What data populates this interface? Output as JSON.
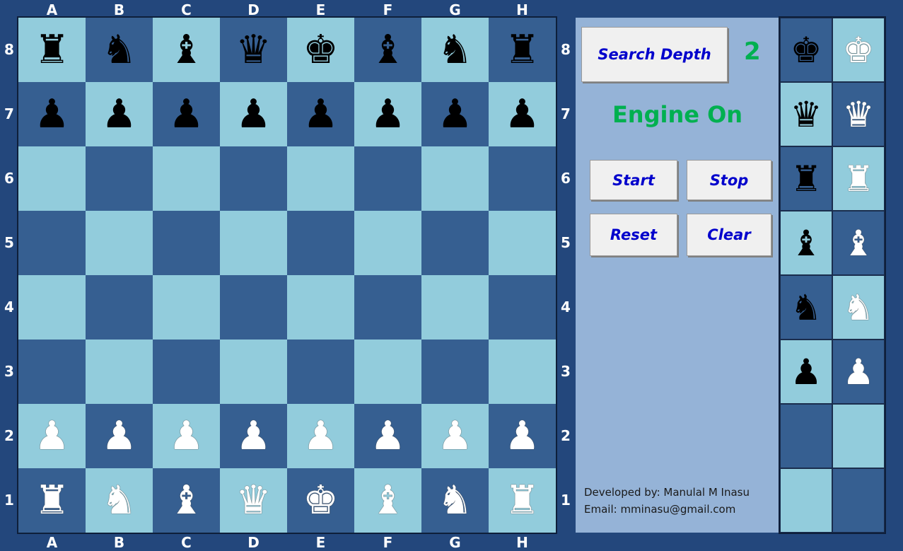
{
  "files": [
    "A",
    "B",
    "C",
    "D",
    "E",
    "F",
    "G",
    "H"
  ],
  "ranks": [
    "8",
    "7",
    "6",
    "5",
    "4",
    "3",
    "2",
    "1"
  ],
  "colors": {
    "light_square": "#92ccdc",
    "dark_square": "#365f91",
    "panel": "#95b3d7",
    "accent_green": "#00b050",
    "button_text": "#0000cc"
  },
  "board": [
    [
      {
        "glyph": "♜",
        "color": "black",
        "piece": "rook-icon"
      },
      {
        "glyph": "♞",
        "color": "black",
        "piece": "knight-icon"
      },
      {
        "glyph": "♝",
        "color": "black",
        "piece": "bishop-icon"
      },
      {
        "glyph": "♛",
        "color": "black",
        "piece": "queen-icon"
      },
      {
        "glyph": "♚",
        "color": "black",
        "piece": "king-icon"
      },
      {
        "glyph": "♝",
        "color": "black",
        "piece": "bishop-icon"
      },
      {
        "glyph": "♞",
        "color": "black",
        "piece": "knight-icon"
      },
      {
        "glyph": "♜",
        "color": "black",
        "piece": "rook-icon"
      }
    ],
    [
      {
        "glyph": "♟",
        "color": "black",
        "piece": "pawn-icon"
      },
      {
        "glyph": "♟",
        "color": "black",
        "piece": "pawn-icon"
      },
      {
        "glyph": "♟",
        "color": "black",
        "piece": "pawn-icon"
      },
      {
        "glyph": "♟",
        "color": "black",
        "piece": "pawn-icon"
      },
      {
        "glyph": "♟",
        "color": "black",
        "piece": "pawn-icon"
      },
      {
        "glyph": "♟",
        "color": "black",
        "piece": "pawn-icon"
      },
      {
        "glyph": "♟",
        "color": "black",
        "piece": "pawn-icon"
      },
      {
        "glyph": "♟",
        "color": "black",
        "piece": "pawn-icon"
      }
    ],
    [
      null,
      null,
      null,
      null,
      null,
      null,
      null,
      null
    ],
    [
      null,
      null,
      null,
      null,
      null,
      null,
      null,
      null
    ],
    [
      null,
      null,
      null,
      null,
      null,
      null,
      null,
      null
    ],
    [
      null,
      null,
      null,
      null,
      null,
      null,
      null,
      null
    ],
    [
      {
        "glyph": "♟",
        "color": "white",
        "piece": "pawn-icon"
      },
      {
        "glyph": "♟",
        "color": "white",
        "piece": "pawn-icon"
      },
      {
        "glyph": "♟",
        "color": "white",
        "piece": "pawn-icon"
      },
      {
        "glyph": "♟",
        "color": "white",
        "piece": "pawn-icon"
      },
      {
        "glyph": "♟",
        "color": "white",
        "piece": "pawn-icon"
      },
      {
        "glyph": "♟",
        "color": "white",
        "piece": "pawn-icon"
      },
      {
        "glyph": "♟",
        "color": "white",
        "piece": "pawn-icon"
      },
      {
        "glyph": "♟",
        "color": "white",
        "piece": "pawn-icon"
      }
    ],
    [
      {
        "glyph": "♜",
        "color": "white",
        "piece": "rook-icon"
      },
      {
        "glyph": "♞",
        "color": "white",
        "piece": "knight-icon"
      },
      {
        "glyph": "♝",
        "color": "white",
        "piece": "bishop-icon"
      },
      {
        "glyph": "♛",
        "color": "white",
        "piece": "queen-icon"
      },
      {
        "glyph": "♚",
        "color": "white",
        "piece": "king-icon"
      },
      {
        "glyph": "♝",
        "color": "white",
        "piece": "bishop-icon"
      },
      {
        "glyph": "♞",
        "color": "white",
        "piece": "knight-icon"
      },
      {
        "glyph": "♜",
        "color": "white",
        "piece": "rook-icon"
      }
    ]
  ],
  "panel": {
    "search_depth_label": "Search Depth",
    "search_depth_value": "2",
    "engine_status": "Engine On",
    "start_label": "Start",
    "stop_label": "Stop",
    "reset_label": "Reset",
    "clear_label": "Clear",
    "developer": "Developed by: Manulal M Inasu",
    "email": "Email: mminasu@gmail.com"
  },
  "captured": [
    [
      {
        "glyph": "♚",
        "color": "black",
        "piece": "king-icon",
        "bg": "dark"
      },
      {
        "glyph": "♚",
        "color": "white",
        "piece": "king-icon",
        "bg": "light"
      }
    ],
    [
      {
        "glyph": "♛",
        "color": "black",
        "piece": "queen-icon",
        "bg": "light"
      },
      {
        "glyph": "♛",
        "color": "white",
        "piece": "queen-icon",
        "bg": "dark"
      }
    ],
    [
      {
        "glyph": "♜",
        "color": "black",
        "piece": "rook-icon",
        "bg": "dark"
      },
      {
        "glyph": "♜",
        "color": "white",
        "piece": "rook-icon",
        "bg": "light"
      }
    ],
    [
      {
        "glyph": "♝",
        "color": "black",
        "piece": "bishop-icon",
        "bg": "light"
      },
      {
        "glyph": "♝",
        "color": "white",
        "piece": "bishop-icon",
        "bg": "dark"
      }
    ],
    [
      {
        "glyph": "♞",
        "color": "black",
        "piece": "knight-icon",
        "bg": "dark"
      },
      {
        "glyph": "♞",
        "color": "white",
        "piece": "knight-icon",
        "bg": "light"
      }
    ],
    [
      {
        "glyph": "♟",
        "color": "black",
        "piece": "pawn-icon",
        "bg": "light"
      },
      {
        "glyph": "♟",
        "color": "white",
        "piece": "pawn-icon",
        "bg": "dark"
      }
    ],
    [
      {
        "glyph": "",
        "color": "",
        "piece": "",
        "bg": "dark"
      },
      {
        "glyph": "",
        "color": "",
        "piece": "",
        "bg": "light"
      }
    ],
    [
      {
        "glyph": "",
        "color": "",
        "piece": "",
        "bg": "light"
      },
      {
        "glyph": "",
        "color": "",
        "piece": "",
        "bg": "dark"
      }
    ]
  ]
}
